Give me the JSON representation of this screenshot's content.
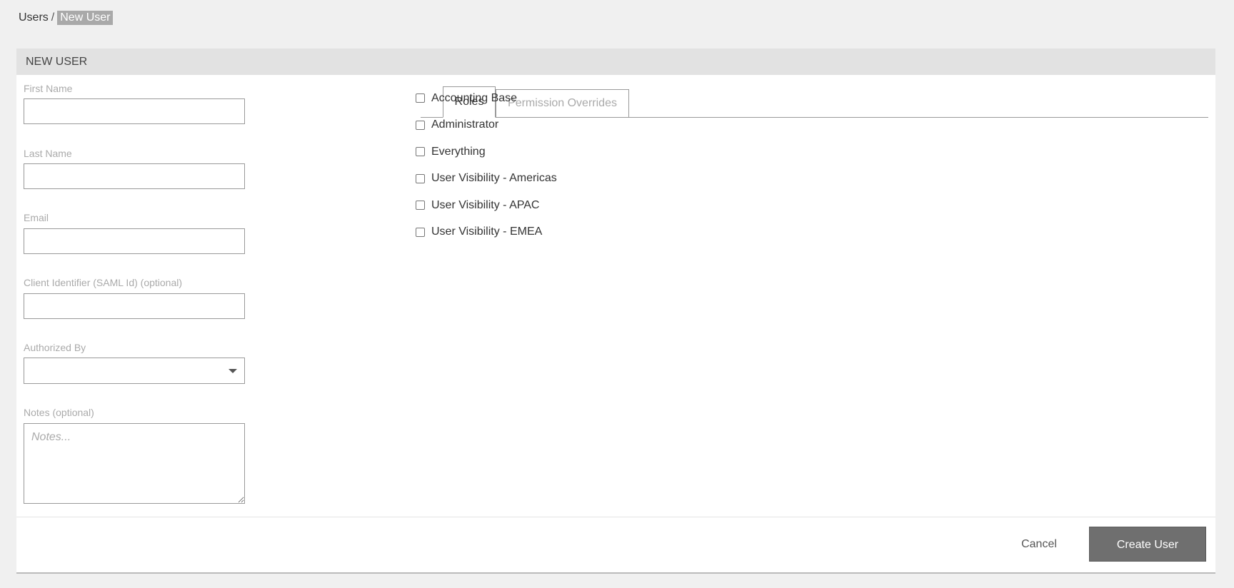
{
  "breadcrumb": {
    "parent": "Users",
    "separator": "/",
    "current": "New User"
  },
  "panel": {
    "title": "NEW USER"
  },
  "form": {
    "first_name": {
      "label": "First Name",
      "value": ""
    },
    "last_name": {
      "label": "Last Name",
      "value": ""
    },
    "email": {
      "label": "Email",
      "value": ""
    },
    "client_identifier": {
      "label": "Client Identifier (SAML Id) (optional)",
      "value": ""
    },
    "authorized_by": {
      "label": "Authorized By",
      "value": ""
    },
    "notes": {
      "label": "Notes (optional)",
      "placeholder": "Notes...",
      "value": ""
    }
  },
  "tabs": [
    {
      "label": "Roles",
      "active": true
    },
    {
      "label": "Permission Overrides",
      "active": false
    }
  ],
  "roles": [
    {
      "label": "Accounting Base",
      "checked": false
    },
    {
      "label": "Administrator",
      "checked": false
    },
    {
      "label": "Everything",
      "checked": false
    },
    {
      "label": "User Visibility - Americas",
      "checked": false
    },
    {
      "label": "User Visibility - APAC",
      "checked": false
    },
    {
      "label": "User Visibility - EMEA",
      "checked": false
    }
  ],
  "actions": {
    "cancel_label": "Cancel",
    "create_label": "Create User"
  },
  "colors": {
    "page_bg": "#f0f0f0",
    "header_bg": "#e2e2e2",
    "primary_button": "#6f6f6f",
    "breadcrumb_highlight": "#a9a9a9"
  }
}
